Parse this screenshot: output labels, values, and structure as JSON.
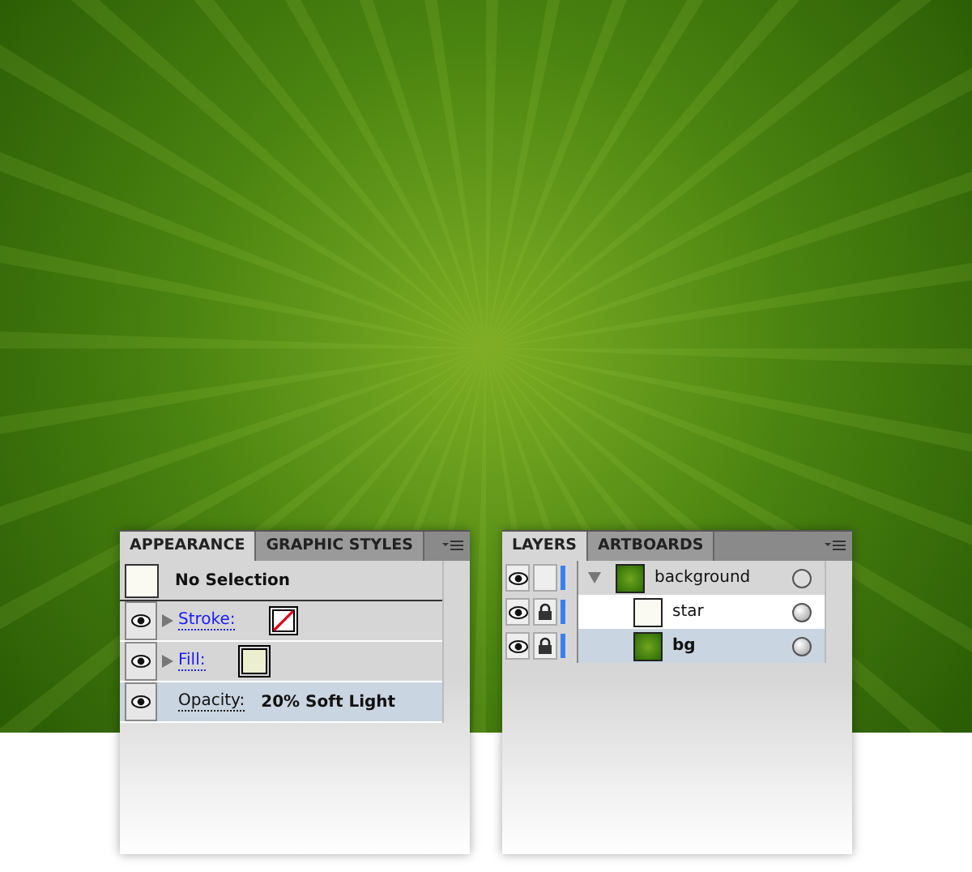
{
  "appearance": {
    "tabs": [
      {
        "label": "APPEARANCE",
        "selected": true
      },
      {
        "label": "GRAPHIC STYLES",
        "selected": false
      }
    ],
    "header": "No Selection",
    "rows": [
      {
        "kind": "stroke",
        "label": "Stroke:",
        "visible": true,
        "selected": false
      },
      {
        "kind": "fill",
        "label": "Fill:",
        "visible": true,
        "selected": false
      },
      {
        "kind": "opacity",
        "label": "Opacity:",
        "value": "20% Soft Light",
        "visible": true,
        "selected": true
      }
    ]
  },
  "layers": {
    "tabs": [
      {
        "label": "LAYERS",
        "selected": true
      },
      {
        "label": "ARTBOARDS",
        "selected": false
      }
    ],
    "items": [
      {
        "name": "background",
        "visible": true,
        "locked": false,
        "expanded": true,
        "selected": false,
        "children": [
          {
            "name": "star",
            "visible": true,
            "locked": true,
            "selected": false
          },
          {
            "name": "bg",
            "visible": true,
            "locked": true,
            "selected": true
          }
        ]
      }
    ]
  }
}
